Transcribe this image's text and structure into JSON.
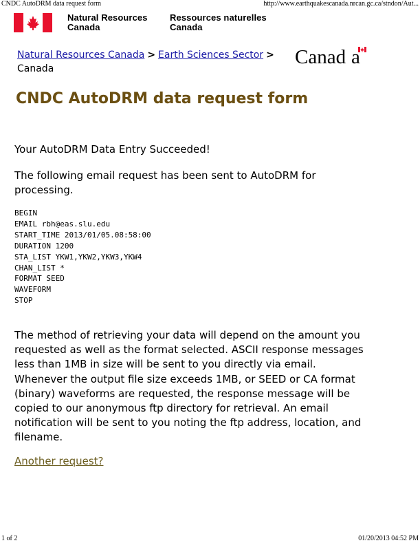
{
  "print_header": {
    "title": "CNDC AutoDRM data request form",
    "url": "http://www.earthquakescanada.nrcan.gc.ca/stndon/Aut..."
  },
  "fip": {
    "dept_en_line1": "Natural Resources",
    "dept_en_line2": "Canada",
    "dept_fr_line1": "Ressources naturelles",
    "dept_fr_line2": "Canada",
    "flag_icon": "canada-flag-icon",
    "wordmark": "Canada"
  },
  "breadcrumb": {
    "items": [
      "Natural Resources Canada",
      "Earth Sciences Sector",
      "Canada"
    ],
    "separator": ">"
  },
  "page_title": "CNDC AutoDRM data request form",
  "success_message": "Your AutoDRM Data Entry Succeeded!",
  "sent_message": "The following email request has been sent to AutoDRM for processing.",
  "request_lines": [
    "BEGIN",
    "EMAIL rbh@eas.slu.edu",
    "START_TIME 2013/01/05.08:58:00",
    "DURATION 1200",
    "STA_LIST YKW1,YKW2,YKW3,YKW4",
    "CHAN_LIST *",
    "FORMAT SEED",
    "WAVEFORM",
    "STOP"
  ],
  "method_paragraph": "The method of retrieving your data will depend on the amount you requested as well as the format selected. ASCII response messages less than 1MB in size will be sent to you directly via email. Whenever the output file size exceeds 1MB, or SEED or CA format (binary) waveforms are requested, the response message will be copied to our anonymous ftp directory for retrieval. An email notification will be sent to you noting the ftp address, location, and filename.",
  "another_request_link": "Another request?",
  "print_footer": {
    "page": "1 of 2",
    "datetime": "01/20/2013 04:52 PM"
  },
  "colors": {
    "title": "#6b4f12",
    "link": "#1a1aa6",
    "flag_red": "#e8112d"
  }
}
